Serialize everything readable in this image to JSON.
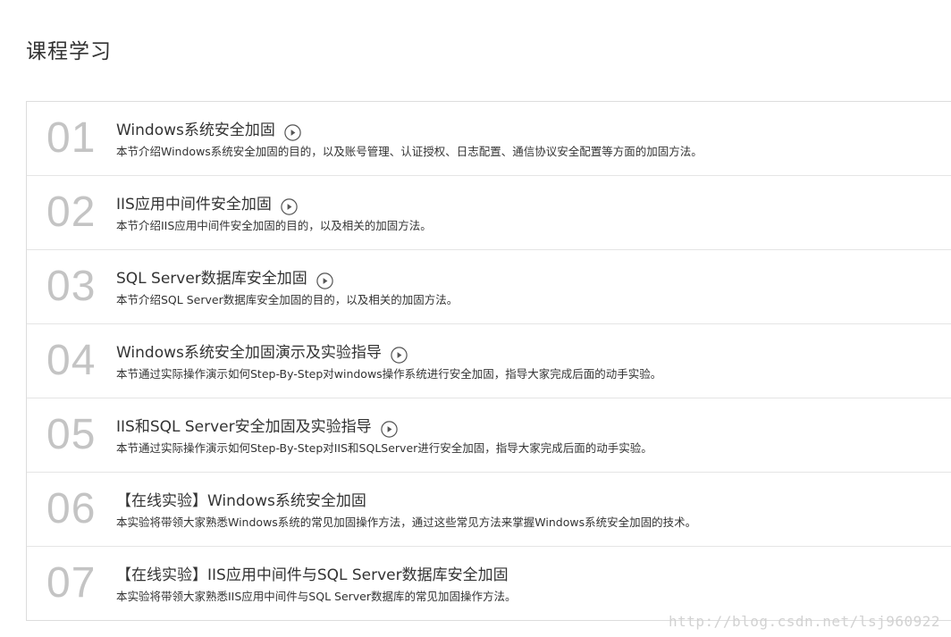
{
  "page": {
    "title": "课程学习"
  },
  "courses": [
    {
      "num": "01",
      "title": "Windows系统安全加固",
      "desc": "本节介绍Windows系统安全加固的目的，以及账号管理、认证授权、日志配置、通信协议安全配置等方面的加固方法。",
      "has_play": true,
      "play_icon": "play-circle-icon"
    },
    {
      "num": "02",
      "title": "IIS应用中间件安全加固",
      "desc": "本节介绍IIS应用中间件安全加固的目的，以及相关的加固方法。",
      "has_play": true,
      "play_icon": "play-circle-icon"
    },
    {
      "num": "03",
      "title": "SQL Server数据库安全加固",
      "desc": "本节介绍SQL Server数据库安全加固的目的，以及相关的加固方法。",
      "has_play": true,
      "play_icon": "play-circle-icon"
    },
    {
      "num": "04",
      "title": "Windows系统安全加固演示及实验指导",
      "desc": "本节通过实际操作演示如何Step-By-Step对windows操作系统进行安全加固，指导大家完成后面的动手实验。",
      "has_play": true,
      "play_icon": "play-circle-icon"
    },
    {
      "num": "05",
      "title": "IIS和SQL Server安全加固及实验指导",
      "desc": "本节通过实际操作演示如何Step-By-Step对IIS和SQLServer进行安全加固，指导大家完成后面的动手实验。",
      "has_play": true,
      "play_icon": "play-circle-icon"
    },
    {
      "num": "06",
      "title": "【在线实验】Windows系统安全加固",
      "desc": "本实验将带领大家熟悉Windows系统的常见加固操作方法，通过这些常见方法来掌握Windows系统安全加固的技术。",
      "has_play": false
    },
    {
      "num": "07",
      "title": "【在线实验】IIS应用中间件与SQL Server数据库安全加固",
      "desc": "本实验将带领大家熟悉IIS应用中间件与SQL Server数据库的常见加固操作方法。",
      "has_play": false
    }
  ],
  "watermark": {
    "text": "http://blog.csdn.net/lsj960922"
  },
  "colors": {
    "number": "#c4c4c4",
    "border": "#dddddd",
    "text": "#333333",
    "icon": "#555555"
  }
}
